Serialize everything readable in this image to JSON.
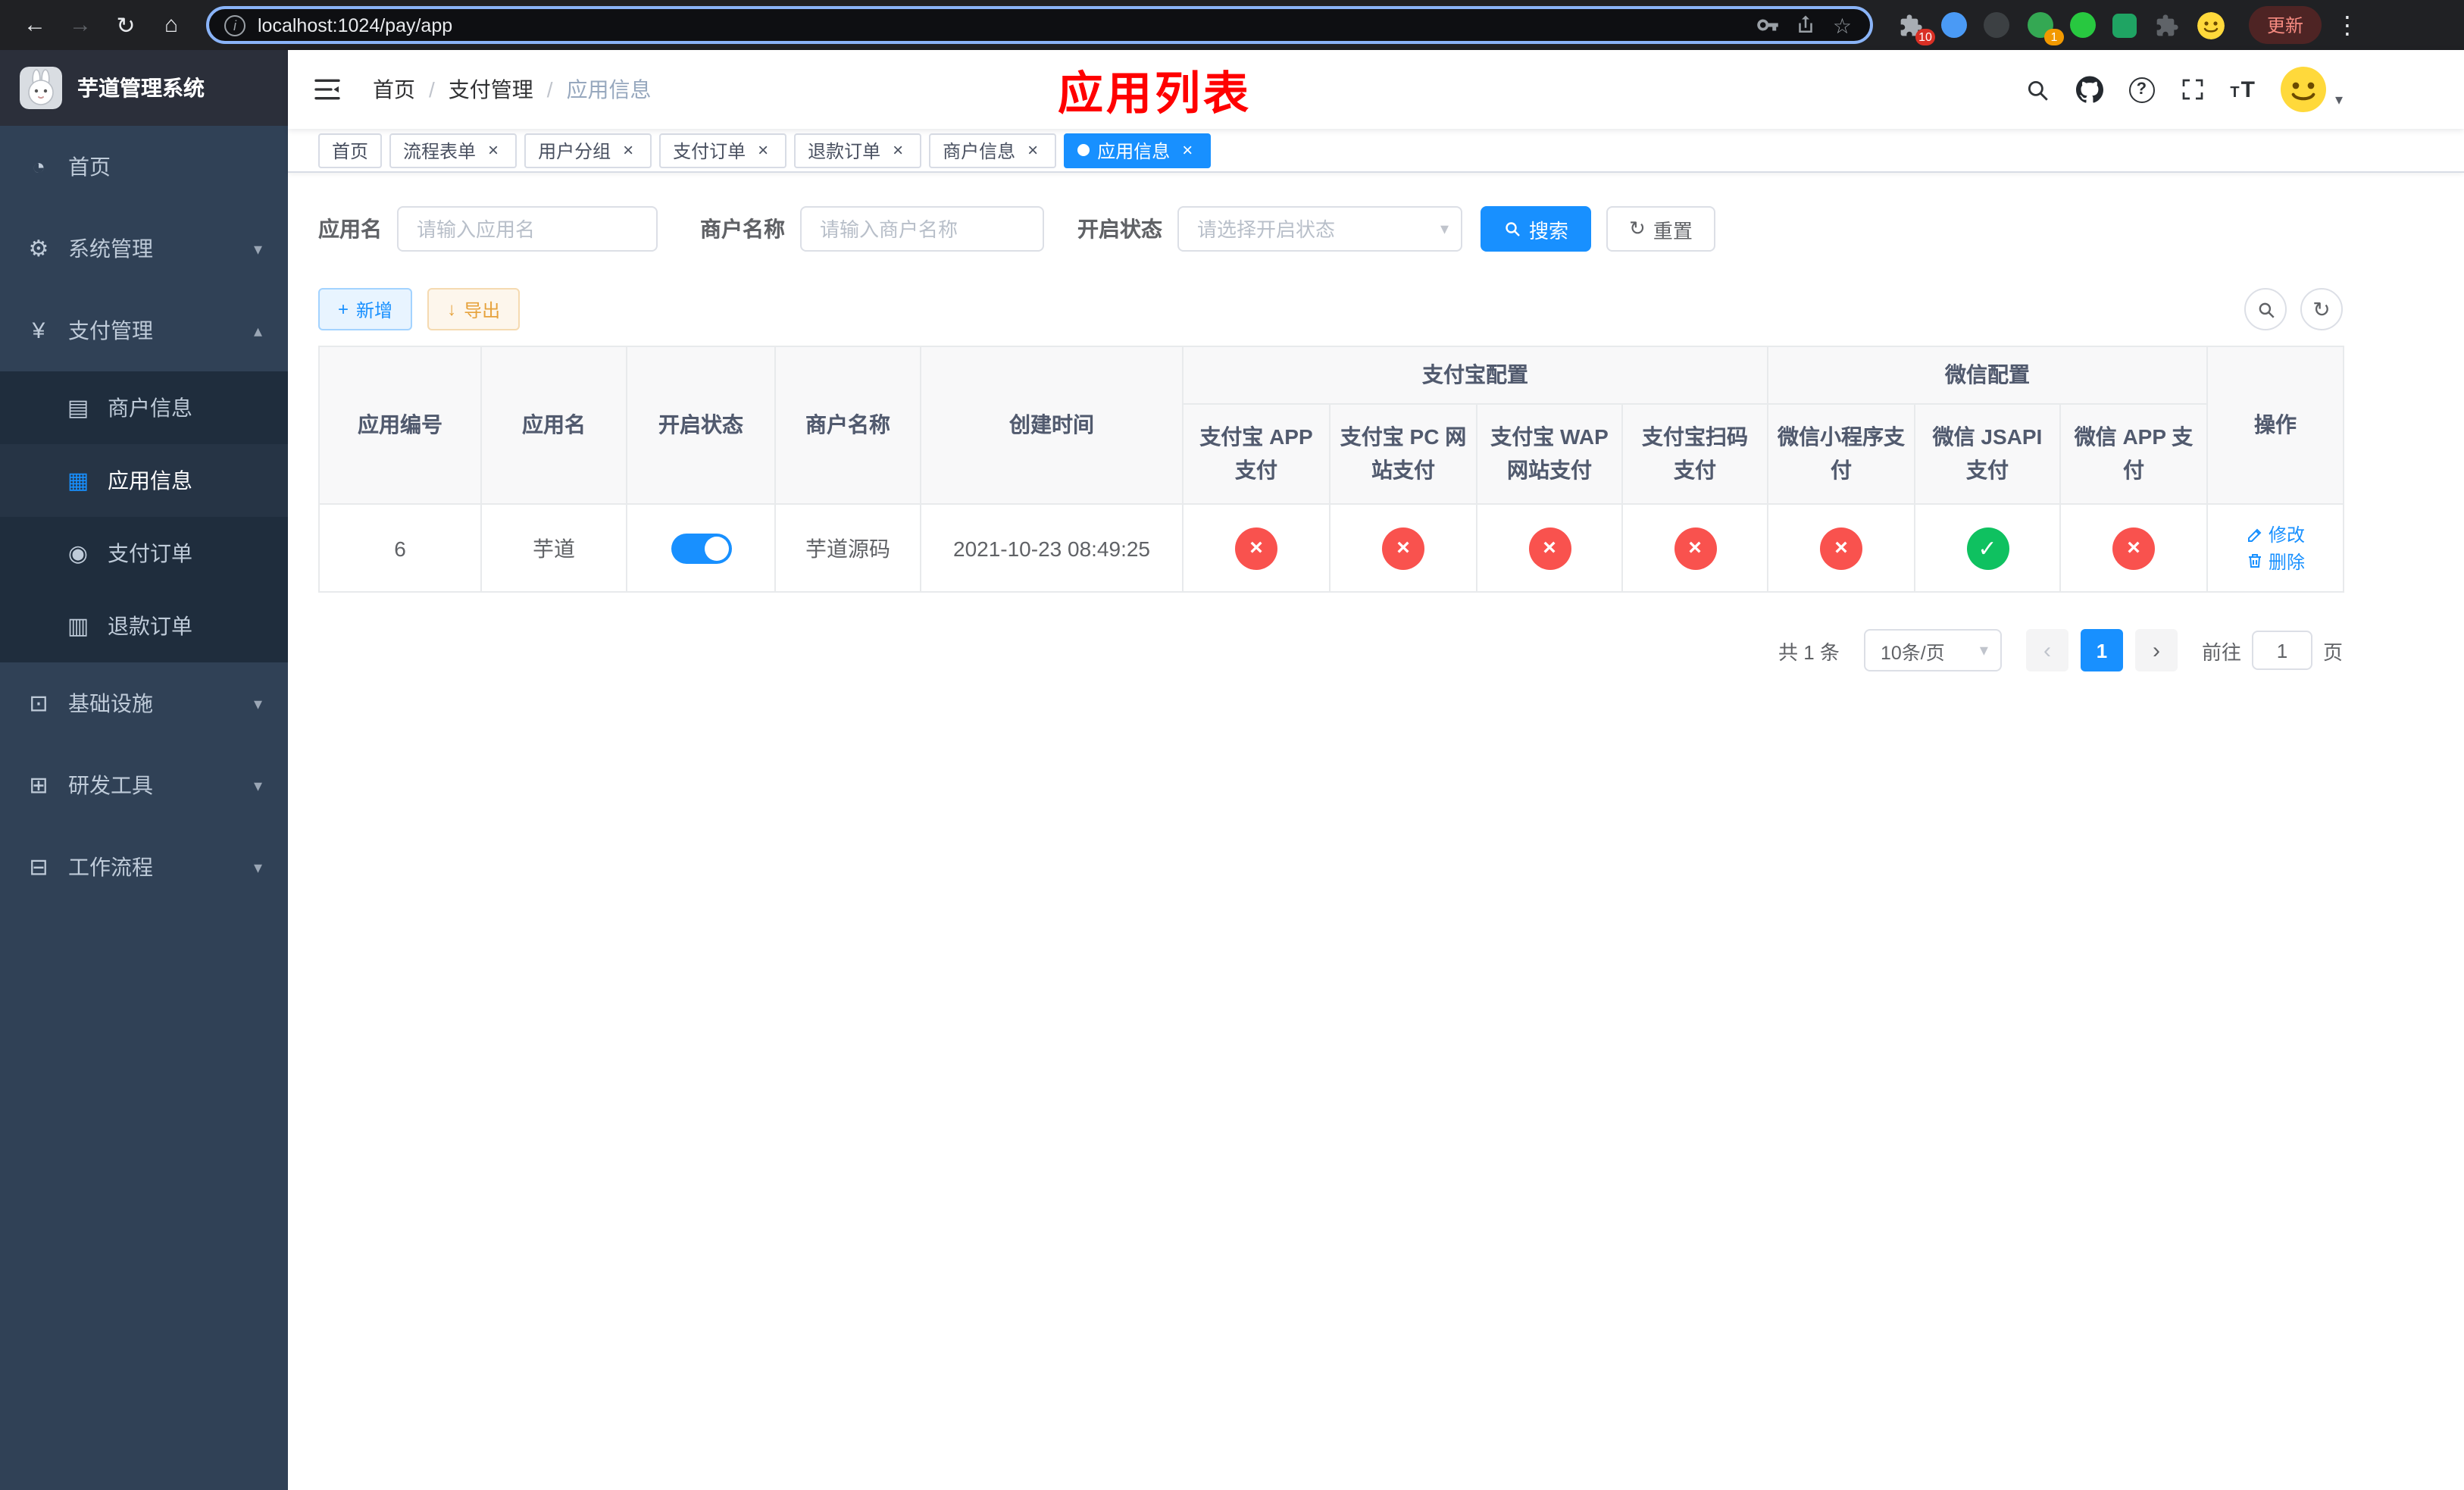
{
  "browser": {
    "url": "localhost:1024/pay/app",
    "update_button": "更新",
    "extensions_badge": "10",
    "profile_badge": "1"
  },
  "navbar": {
    "breadcrumb": [
      "首页",
      "支付管理",
      "应用信息"
    ],
    "separator": "/",
    "annotation": "应用列表"
  },
  "sidebar": {
    "app_title": "芋道管理系统",
    "menu": [
      {
        "label": "首页",
        "expandable": false
      },
      {
        "label": "系统管理",
        "expandable": true,
        "expanded": false
      },
      {
        "label": "支付管理",
        "expandable": true,
        "expanded": true
      },
      {
        "label": "基础设施",
        "expandable": true,
        "expanded": false
      },
      {
        "label": "研发工具",
        "expandable": true,
        "expanded": false
      },
      {
        "label": "工作流程",
        "expandable": true,
        "expanded": false
      }
    ],
    "submenu": [
      {
        "label": "商户信息",
        "active": false
      },
      {
        "label": "应用信息",
        "active": true
      },
      {
        "label": "支付订单",
        "active": false
      },
      {
        "label": "退款订单",
        "active": false
      }
    ]
  },
  "tabs": [
    {
      "label": "首页",
      "closable": false,
      "active": false
    },
    {
      "label": "流程表单",
      "closable": true,
      "active": false
    },
    {
      "label": "用户分组",
      "closable": true,
      "active": false
    },
    {
      "label": "支付订单",
      "closable": true,
      "active": false
    },
    {
      "label": "退款订单",
      "closable": true,
      "active": false
    },
    {
      "label": "商户信息",
      "closable": true,
      "active": false
    },
    {
      "label": "应用信息",
      "closable": true,
      "active": true
    }
  ],
  "filters": {
    "app_name": {
      "label": "应用名",
      "placeholder": "请输入应用名",
      "value": ""
    },
    "merchant_name": {
      "label": "商户名称",
      "placeholder": "请输入商户名称",
      "value": ""
    },
    "status": {
      "label": "开启状态",
      "placeholder": "请选择开启状态",
      "value": ""
    },
    "search_button": "搜索",
    "reset_button": "重置"
  },
  "toolbar": {
    "add_button": "新增",
    "export_button": "导出"
  },
  "table": {
    "plain_headers": [
      "应用编号",
      "应用名",
      "开启状态",
      "商户名称",
      "创建时间"
    ],
    "alipay_group": "支付宝配置",
    "wechat_group": "微信配置",
    "pay_headers": [
      "支付宝 APP 支付",
      "支付宝 PC 网站支付",
      "支付宝 WAP 网站支付",
      "支付宝扫码支付",
      "微信小程序支付",
      "微信 JSAPI 支付",
      "微信 APP 支付"
    ],
    "ops_header": "操作",
    "row": {
      "id": "6",
      "name": "芋道",
      "enabled": true,
      "merchant": "芋道源码",
      "created": "2021-10-23 08:49:25",
      "pay_flags": [
        false,
        false,
        false,
        false,
        false,
        true,
        false
      ],
      "edit_label": "修改",
      "delete_label": "删除"
    }
  },
  "pagination": {
    "total_label": "共 1 条",
    "page_size": "10条/页",
    "current_page": "1",
    "goto_prefix": "前往",
    "goto_value": "1",
    "goto_suffix": "页"
  },
  "icons": {
    "back": "←",
    "forward": "→",
    "reload": "↻",
    "home": "⌂",
    "info": "i",
    "star": "☆",
    "kebab": "⋮",
    "dashboard": "◔",
    "gear": "⚙",
    "yen": "¥",
    "infra": "⊡",
    "tools": "⊞",
    "workflow": "⊟",
    "merchant": "▤",
    "app_grid": "▦",
    "pay_order": "◉",
    "refund_order": "▥",
    "chevron_down": "▾",
    "chevron_up": "▴",
    "caret_down": "▾",
    "plus": "+",
    "download": "↓",
    "refresh": "↻",
    "check": "✓",
    "cross": "×",
    "close": "×",
    "help": "?",
    "text": "T",
    "prev": "‹",
    "next": "›"
  },
  "colors": {
    "accent": "#1890ff",
    "sidebar_bg": "#304156",
    "danger_icon": "#f9524e",
    "success_icon": "#0fc160",
    "annotation_red": "#ff0000",
    "export_orange": "#e6a23c"
  }
}
